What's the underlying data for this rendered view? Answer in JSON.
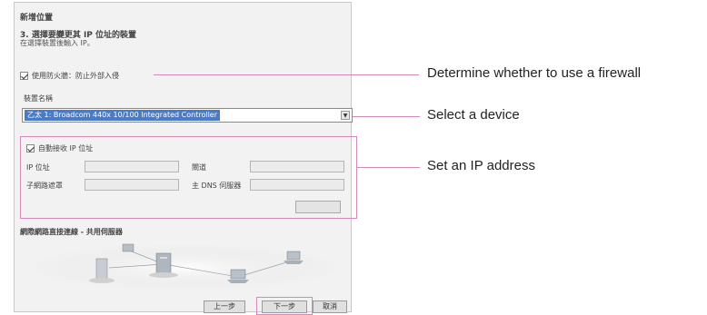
{
  "dialog": {
    "title": "新增位置",
    "step_title": "3. 選擇要變更其 IP 位址的裝置",
    "step_subtitle": "在選擇裝置後輸入 IP。"
  },
  "firewall": {
    "label": "使用防火牆：防止外部入侵",
    "checked": true
  },
  "device": {
    "label": "裝置名稱",
    "selected": "乙太 1: Broadcom 440x 10/100 Integrated Controller"
  },
  "ip": {
    "auto_label": "自動接收 IP 位址",
    "auto_checked": true,
    "ip_label": "IP 位址",
    "gateway_label": "閘道",
    "subnet_label": "子網路遮罩",
    "dns_label": "主 DNS 伺服器",
    "ip_value": "",
    "gateway_value": "",
    "subnet_value": "",
    "dns_value": ""
  },
  "network": {
    "title": "網際網路直接連線 - 共用伺服器"
  },
  "buttons": {
    "prev": "上一步",
    "next": "下一步",
    "cancel": "取消"
  },
  "callouts": {
    "firewall": "Determine whether to use a firewall",
    "device": "Select a device",
    "ip": "Set an IP address"
  },
  "colors": {
    "accent_line": "#d48ab8",
    "selection": "#4a7bc8"
  }
}
